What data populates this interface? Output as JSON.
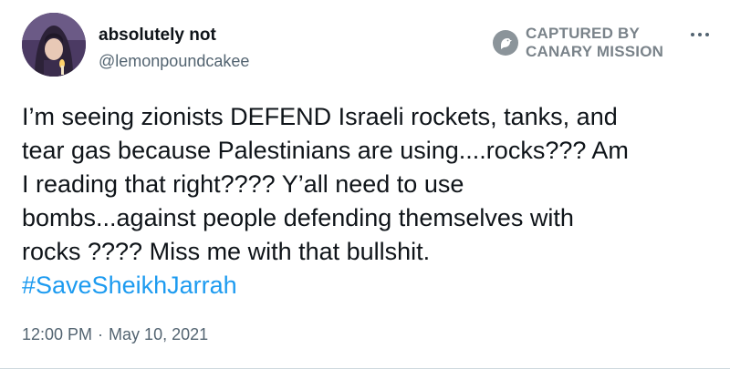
{
  "author": {
    "display_name": "absolutely not",
    "handle": "@lemonpoundcakee",
    "avatar_icon": "user-avatar-hooded-figure-icon"
  },
  "watermark": {
    "line1": "CAPTURED BY",
    "line2": "CANARY MISSION",
    "logo_icon": "canary-bird-icon"
  },
  "menu": {
    "more_icon": "more-options-icon"
  },
  "tweet": {
    "lines": [
      "I’m seeing zionists DEFEND Israeli rockets, tanks, and",
      "tear gas because Palestinians are using....rocks??? Am",
      "I reading that right???? Y’all need to use",
      "bombs...against people defending themselves with",
      "rocks ???? Miss me with that bullshit."
    ],
    "hashtag": "#SaveSheikhJarrah"
  },
  "meta": {
    "time": "12:00 PM",
    "separator": "·",
    "date": "May 10, 2021"
  },
  "colors": {
    "link": "#1d9bf0",
    "secondary_text": "#536471",
    "primary_text": "#0f1419",
    "watermark": "#7a838a"
  }
}
